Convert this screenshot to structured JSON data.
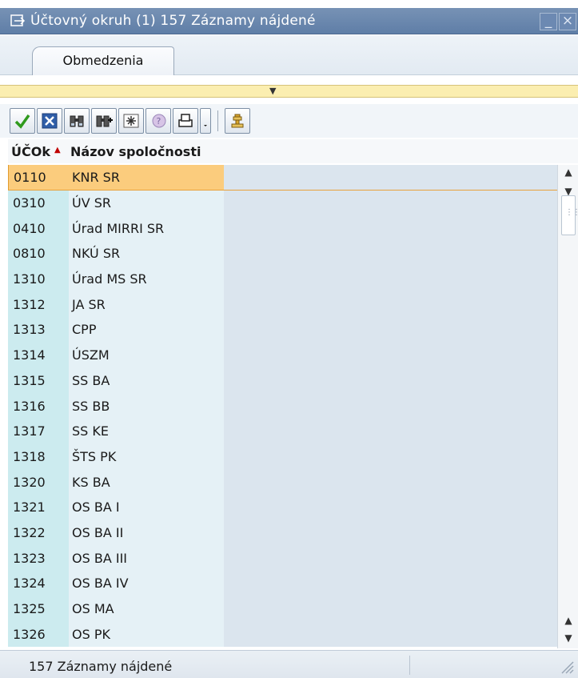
{
  "window": {
    "title": "Účtovný okruh (1)  157 Záznamy nájdené"
  },
  "tabs": [
    {
      "label": "Obmedzenia"
    }
  ],
  "table": {
    "headers": {
      "code": "ÚČOk",
      "name": "Názov spoločnosti"
    },
    "rows": [
      {
        "code": "0110",
        "name": "KNR SR"
      },
      {
        "code": "0310",
        "name": "ÚV SR"
      },
      {
        "code": "0410",
        "name": "Úrad MIRRI SR"
      },
      {
        "code": "0810",
        "name": "NKÚ SR"
      },
      {
        "code": "1310",
        "name": "Úrad MS SR"
      },
      {
        "code": "1312",
        "name": "JA SR"
      },
      {
        "code": "1313",
        "name": "CPP"
      },
      {
        "code": "1314",
        "name": "ÚSZM"
      },
      {
        "code": "1315",
        "name": "SS BA"
      },
      {
        "code": "1316",
        "name": "SS BB"
      },
      {
        "code": "1317",
        "name": "SS KE"
      },
      {
        "code": "1318",
        "name": "ŠTS PK"
      },
      {
        "code": "1320",
        "name": "KS BA"
      },
      {
        "code": "1321",
        "name": "OS BA I"
      },
      {
        "code": "1322",
        "name": "OS BA II"
      },
      {
        "code": "1323",
        "name": "OS BA III"
      },
      {
        "code": "1324",
        "name": "OS BA IV"
      },
      {
        "code": "1325",
        "name": "OS MA"
      },
      {
        "code": "1326",
        "name": "OS PK"
      }
    ]
  },
  "status": {
    "text": "157 Záznamy nájdené"
  },
  "colors": {
    "title_bar": "#6784ab",
    "selected_row": "#fbcc7d",
    "code_column": "#ccebef"
  }
}
